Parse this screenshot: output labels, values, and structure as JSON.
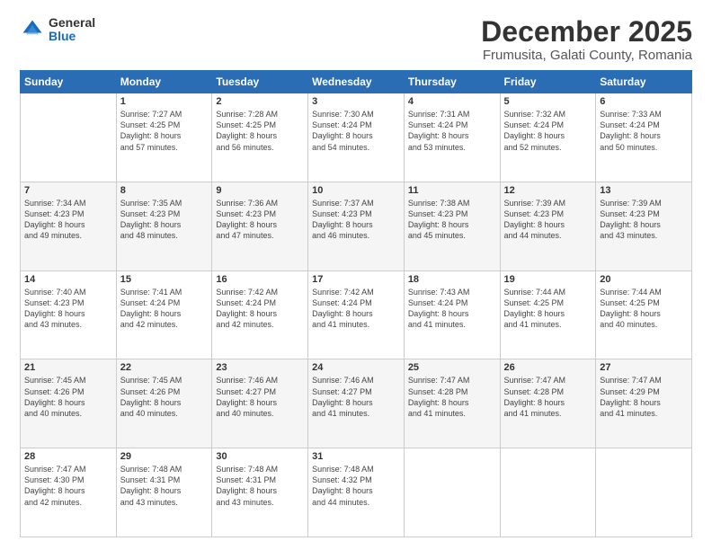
{
  "logo": {
    "general": "General",
    "blue": "Blue"
  },
  "header": {
    "month": "December 2025",
    "location": "Frumusita, Galati County, Romania"
  },
  "weekdays": [
    "Sunday",
    "Monday",
    "Tuesday",
    "Wednesday",
    "Thursday",
    "Friday",
    "Saturday"
  ],
  "weeks": [
    [
      {
        "num": "",
        "sunrise": "",
        "sunset": "",
        "daylight": ""
      },
      {
        "num": "1",
        "sunrise": "Sunrise: 7:27 AM",
        "sunset": "Sunset: 4:25 PM",
        "daylight": "Daylight: 8 hours and 57 minutes."
      },
      {
        "num": "2",
        "sunrise": "Sunrise: 7:28 AM",
        "sunset": "Sunset: 4:25 PM",
        "daylight": "Daylight: 8 hours and 56 minutes."
      },
      {
        "num": "3",
        "sunrise": "Sunrise: 7:30 AM",
        "sunset": "Sunset: 4:24 PM",
        "daylight": "Daylight: 8 hours and 54 minutes."
      },
      {
        "num": "4",
        "sunrise": "Sunrise: 7:31 AM",
        "sunset": "Sunset: 4:24 PM",
        "daylight": "Daylight: 8 hours and 53 minutes."
      },
      {
        "num": "5",
        "sunrise": "Sunrise: 7:32 AM",
        "sunset": "Sunset: 4:24 PM",
        "daylight": "Daylight: 8 hours and 52 minutes."
      },
      {
        "num": "6",
        "sunrise": "Sunrise: 7:33 AM",
        "sunset": "Sunset: 4:24 PM",
        "daylight": "Daylight: 8 hours and 50 minutes."
      }
    ],
    [
      {
        "num": "7",
        "sunrise": "Sunrise: 7:34 AM",
        "sunset": "Sunset: 4:23 PM",
        "daylight": "Daylight: 8 hours and 49 minutes."
      },
      {
        "num": "8",
        "sunrise": "Sunrise: 7:35 AM",
        "sunset": "Sunset: 4:23 PM",
        "daylight": "Daylight: 8 hours and 48 minutes."
      },
      {
        "num": "9",
        "sunrise": "Sunrise: 7:36 AM",
        "sunset": "Sunset: 4:23 PM",
        "daylight": "Daylight: 8 hours and 47 minutes."
      },
      {
        "num": "10",
        "sunrise": "Sunrise: 7:37 AM",
        "sunset": "Sunset: 4:23 PM",
        "daylight": "Daylight: 8 hours and 46 minutes."
      },
      {
        "num": "11",
        "sunrise": "Sunrise: 7:38 AM",
        "sunset": "Sunset: 4:23 PM",
        "daylight": "Daylight: 8 hours and 45 minutes."
      },
      {
        "num": "12",
        "sunrise": "Sunrise: 7:39 AM",
        "sunset": "Sunset: 4:23 PM",
        "daylight": "Daylight: 8 hours and 44 minutes."
      },
      {
        "num": "13",
        "sunrise": "Sunrise: 7:39 AM",
        "sunset": "Sunset: 4:23 PM",
        "daylight": "Daylight: 8 hours and 43 minutes."
      }
    ],
    [
      {
        "num": "14",
        "sunrise": "Sunrise: 7:40 AM",
        "sunset": "Sunset: 4:23 PM",
        "daylight": "Daylight: 8 hours and 43 minutes."
      },
      {
        "num": "15",
        "sunrise": "Sunrise: 7:41 AM",
        "sunset": "Sunset: 4:24 PM",
        "daylight": "Daylight: 8 hours and 42 minutes."
      },
      {
        "num": "16",
        "sunrise": "Sunrise: 7:42 AM",
        "sunset": "Sunset: 4:24 PM",
        "daylight": "Daylight: 8 hours and 42 minutes."
      },
      {
        "num": "17",
        "sunrise": "Sunrise: 7:42 AM",
        "sunset": "Sunset: 4:24 PM",
        "daylight": "Daylight: 8 hours and 41 minutes."
      },
      {
        "num": "18",
        "sunrise": "Sunrise: 7:43 AM",
        "sunset": "Sunset: 4:24 PM",
        "daylight": "Daylight: 8 hours and 41 minutes."
      },
      {
        "num": "19",
        "sunrise": "Sunrise: 7:44 AM",
        "sunset": "Sunset: 4:25 PM",
        "daylight": "Daylight: 8 hours and 41 minutes."
      },
      {
        "num": "20",
        "sunrise": "Sunrise: 7:44 AM",
        "sunset": "Sunset: 4:25 PM",
        "daylight": "Daylight: 8 hours and 40 minutes."
      }
    ],
    [
      {
        "num": "21",
        "sunrise": "Sunrise: 7:45 AM",
        "sunset": "Sunset: 4:26 PM",
        "daylight": "Daylight: 8 hours and 40 minutes."
      },
      {
        "num": "22",
        "sunrise": "Sunrise: 7:45 AM",
        "sunset": "Sunset: 4:26 PM",
        "daylight": "Daylight: 8 hours and 40 minutes."
      },
      {
        "num": "23",
        "sunrise": "Sunrise: 7:46 AM",
        "sunset": "Sunset: 4:27 PM",
        "daylight": "Daylight: 8 hours and 40 minutes."
      },
      {
        "num": "24",
        "sunrise": "Sunrise: 7:46 AM",
        "sunset": "Sunset: 4:27 PM",
        "daylight": "Daylight: 8 hours and 41 minutes."
      },
      {
        "num": "25",
        "sunrise": "Sunrise: 7:47 AM",
        "sunset": "Sunset: 4:28 PM",
        "daylight": "Daylight: 8 hours and 41 minutes."
      },
      {
        "num": "26",
        "sunrise": "Sunrise: 7:47 AM",
        "sunset": "Sunset: 4:28 PM",
        "daylight": "Daylight: 8 hours and 41 minutes."
      },
      {
        "num": "27",
        "sunrise": "Sunrise: 7:47 AM",
        "sunset": "Sunset: 4:29 PM",
        "daylight": "Daylight: 8 hours and 41 minutes."
      }
    ],
    [
      {
        "num": "28",
        "sunrise": "Sunrise: 7:47 AM",
        "sunset": "Sunset: 4:30 PM",
        "daylight": "Daylight: 8 hours and 42 minutes."
      },
      {
        "num": "29",
        "sunrise": "Sunrise: 7:48 AM",
        "sunset": "Sunset: 4:31 PM",
        "daylight": "Daylight: 8 hours and 43 minutes."
      },
      {
        "num": "30",
        "sunrise": "Sunrise: 7:48 AM",
        "sunset": "Sunset: 4:31 PM",
        "daylight": "Daylight: 8 hours and 43 minutes."
      },
      {
        "num": "31",
        "sunrise": "Sunrise: 7:48 AM",
        "sunset": "Sunset: 4:32 PM",
        "daylight": "Daylight: 8 hours and 44 minutes."
      },
      {
        "num": "",
        "sunrise": "",
        "sunset": "",
        "daylight": ""
      },
      {
        "num": "",
        "sunrise": "",
        "sunset": "",
        "daylight": ""
      },
      {
        "num": "",
        "sunrise": "",
        "sunset": "",
        "daylight": ""
      }
    ]
  ]
}
